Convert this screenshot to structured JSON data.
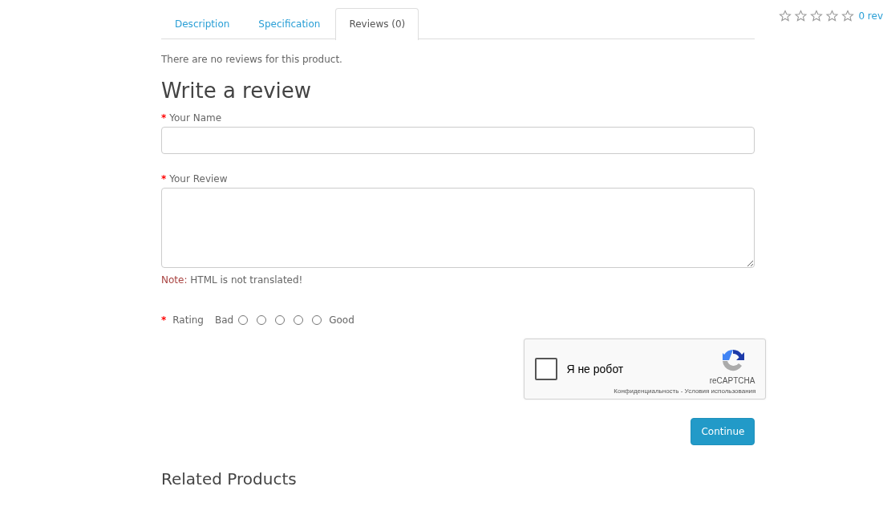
{
  "tabs": [
    {
      "label": "Description",
      "selected": false
    },
    {
      "label": "Specification",
      "selected": false
    },
    {
      "label": "Reviews (0)",
      "selected": true
    }
  ],
  "no_reviews_text": "There are no reviews for this product.",
  "review_form": {
    "title": "Write a review",
    "name_field": {
      "label": "Your Name",
      "required_mark": "*"
    },
    "review_field": {
      "label": "Your Review",
      "required_mark": "*"
    },
    "note": {
      "prefix": "Note:",
      "text": "HTML is not translated!"
    },
    "rating": {
      "label": "Rating",
      "required_mark": "*",
      "low_label": "Bad",
      "high_label": "Good",
      "options": [
        {
          "selected": false
        },
        {
          "selected": false
        },
        {
          "selected": false
        },
        {
          "selected": false
        },
        {
          "selected": false
        }
      ]
    },
    "captcha": {
      "checked": false,
      "label": "Я не робот",
      "brand": "reCAPTCHA",
      "privacy_link": "Конфиденциальность",
      "separator": "-",
      "terms_link": "Условия использования"
    },
    "submit_button": "Continue"
  },
  "related_title": "Related Products",
  "product_rating": {
    "stars": 0,
    "reviews_link": "0 rev"
  }
}
